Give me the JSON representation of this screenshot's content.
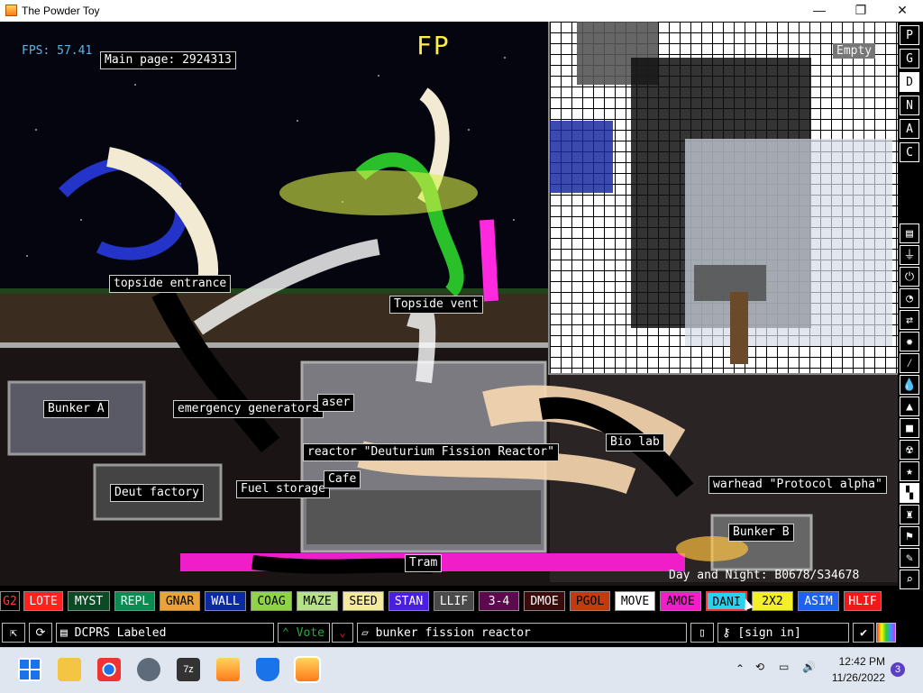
{
  "window": {
    "title": "The Powder Toy",
    "minimize_glyph": "—",
    "maximize_glyph": "❐",
    "close_glyph": "✕"
  },
  "sim": {
    "fps": "FPS: 57.41",
    "main_page": "Main page: 2924313",
    "top_overlay": "FP",
    "zoom_hint": "Empty",
    "signs": {
      "topside_entrance": "topside entrance",
      "topside_vent": "Topside vent",
      "bunker_a": "Bunker A",
      "emergency_generators": "emergency generators",
      "laser": "aser",
      "reactor": "reactor \"Deuturium Fission Reactor\"",
      "bio_lab": "Bio lab",
      "deut_factory": "Deut factory",
      "fuel_storage": "Fuel storage",
      "cafe": "Cafe",
      "warhead": "warhead \"Protocol alpha\"",
      "bunker_b": "Bunker B",
      "tram": "Tram",
      "day_night": "Day and Night: B0678/S34678"
    }
  },
  "right_tools": [
    "P",
    "G",
    "D",
    "N",
    "A",
    "C"
  ],
  "elements": [
    {
      "label": "G2",
      "bg": "#000000",
      "fg": "#ff3b3b"
    },
    {
      "label": "LOTE",
      "bg": "#ff2020",
      "fg": "#ffffff"
    },
    {
      "label": "MYST",
      "bg": "#0c4a26",
      "fg": "#ffffff"
    },
    {
      "label": "REPL",
      "bg": "#0b8a52",
      "fg": "#ffffff"
    },
    {
      "label": "GNAR",
      "bg": "#e6a43b",
      "fg": "#000000"
    },
    {
      "label": "WALL",
      "bg": "#0c2aa0",
      "fg": "#ffffff"
    },
    {
      "label": "COAG",
      "bg": "#8fd448",
      "fg": "#000000"
    },
    {
      "label": "MAZE",
      "bg": "#b7e08a",
      "fg": "#000000"
    },
    {
      "label": "SEED",
      "bg": "#f3e9a0",
      "fg": "#000000"
    },
    {
      "label": "STAN",
      "bg": "#4a1ee0",
      "fg": "#ffffff"
    },
    {
      "label": "LLIF",
      "bg": "#4a4a4a",
      "fg": "#ffffff"
    },
    {
      "label": "3-4",
      "bg": "#5c0a4e",
      "fg": "#ffffff"
    },
    {
      "label": "DMOE",
      "bg": "#3a0b0b",
      "fg": "#ffffff"
    },
    {
      "label": "PGOL",
      "bg": "#c23a10",
      "fg": "#000000"
    },
    {
      "label": "MOVE",
      "bg": "#ffffff",
      "fg": "#000000"
    },
    {
      "label": "AMOE",
      "bg": "#f01ec8",
      "fg": "#000000"
    },
    {
      "label": "DANI",
      "bg": "#2ad2f0",
      "fg": "#000000"
    },
    {
      "label": "2X2",
      "bg": "#f3f02a",
      "fg": "#000000"
    },
    {
      "label": "ASIM",
      "bg": "#2060f0",
      "fg": "#ffffff"
    },
    {
      "label": "HLIF",
      "bg": "#f01818",
      "fg": "#ffffff"
    }
  ],
  "bottom": {
    "save_name": "DCPRS Labeled",
    "vote_label": "Vote",
    "tags": "bunker fission reactor",
    "signin": "[sign in]"
  },
  "tray": {
    "time": "12:42 PM",
    "date": "11/26/2022",
    "notifications": "3"
  },
  "colors": {
    "accent_cyan": "#5ab5e8",
    "vote_green": "#22aa44"
  }
}
